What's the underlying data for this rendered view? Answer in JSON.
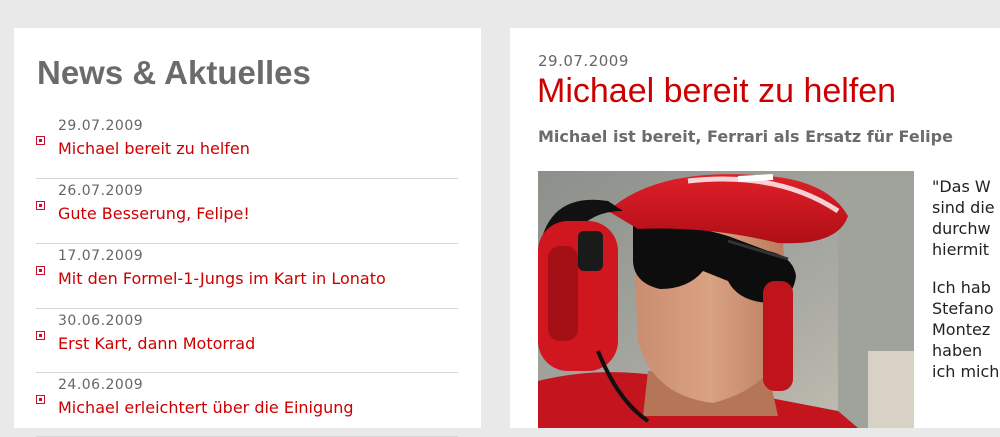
{
  "sidebar": {
    "heading": "News & Aktuelles",
    "items": [
      {
        "date": "29.07.2009",
        "title": "Michael bereit zu helfen"
      },
      {
        "date": "26.07.2009",
        "title": "Gute Besserung, Felipe!"
      },
      {
        "date": "17.07.2009",
        "title": "Mit den Formel-1-Jungs im Kart in Lonato"
      },
      {
        "date": "30.06.2009",
        "title": "Erst Kart, dann Motorrad"
      },
      {
        "date": "24.06.2009",
        "title": "Michael erleichtert über die Einigung"
      }
    ]
  },
  "article": {
    "date": "29.07.2009",
    "title": "Michael bereit zu helfen",
    "lead": "Michael ist bereit, Ferrari als Ersatz für Felipe",
    "paragraph1": [
      "\"Das W",
      "sind die",
      "durchw",
      "hiermit"
    ],
    "paragraph2": [
      "Ich hab",
      "Stefano",
      "Montez",
      "haben",
      "ich mich"
    ]
  },
  "colors": {
    "accent": "#cc0000",
    "background": "#e9e9e9",
    "heading_gray": "#6b6b6b"
  }
}
